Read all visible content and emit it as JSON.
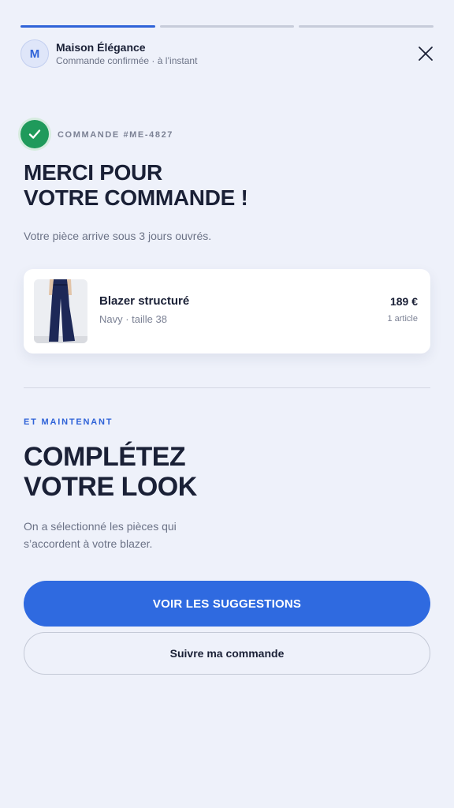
{
  "progress": {
    "total_steps": 3,
    "active_step": 1
  },
  "header": {
    "avatar_letter": "M",
    "brand_name": "Maison Élégance",
    "status": "Commande confirmée · à l’instant"
  },
  "confirmation": {
    "order_label": "COMMANDE #ME-4827",
    "title_line1": "Merci pour",
    "title_line2": "votre commande !",
    "subtitle": "Votre pièce arrive sous 3 jours ouvrés."
  },
  "order_item": {
    "name": "Blazer structuré",
    "meta": "Navy · taille 38",
    "price": "189 €",
    "count": "1 article"
  },
  "upsell": {
    "label": "ET MAINTENANT",
    "title_line1": "Complétez",
    "title_line2": "votre look",
    "text": "On a sélectionné les pièces qui s’accordent à votre blazer."
  },
  "actions": {
    "primary_label": "Voir les suggestions",
    "secondary_label": "Suivre ma commande"
  },
  "colors": {
    "background": "#eef1fa",
    "accent": "#2f63d8",
    "success": "#1f9a5b",
    "text": "#1a2036",
    "muted": "#6b7286"
  },
  "icons": {
    "close": "close-icon",
    "check": "check-icon",
    "product": "product-thumbnail"
  }
}
